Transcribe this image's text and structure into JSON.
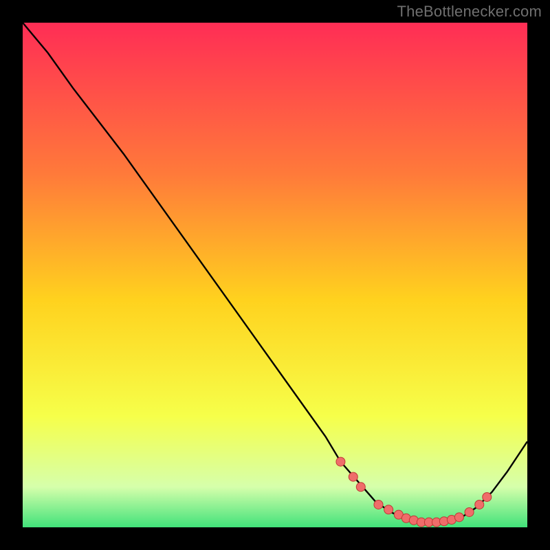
{
  "watermark": "TheBottlenecker.com",
  "colors": {
    "bg": "#000000",
    "watermark": "#6f6f6f",
    "curve": "#000000",
    "dot_fill": "#ef6d6a",
    "dot_stroke": "#c03935",
    "grad_top": "#ff2d55",
    "grad_mid1": "#ff7a3a",
    "grad_mid2": "#ffd21e",
    "grad_mid3": "#f6ff4a",
    "grad_bot1": "#d6ffab",
    "grad_bot2": "#41e27a"
  },
  "chart_data": {
    "type": "line",
    "title": "",
    "xlabel": "",
    "ylabel": "",
    "xlim": [
      0,
      100
    ],
    "ylim": [
      0,
      100
    ],
    "grid": false,
    "legend": false,
    "x": [
      0,
      5,
      10,
      15,
      20,
      25,
      30,
      35,
      40,
      45,
      50,
      55,
      60,
      63,
      66.5,
      70,
      73,
      76,
      79,
      82,
      85,
      87,
      90,
      93,
      96,
      100
    ],
    "values": [
      100,
      94,
      87,
      80.5,
      74,
      67,
      60,
      53,
      46,
      39,
      32,
      25,
      18,
      13,
      9,
      5,
      3,
      1.5,
      1,
      1,
      1.2,
      2,
      4,
      7,
      11,
      17
    ],
    "dots_x": [
      63.0,
      65.5,
      67.0,
      70.5,
      72.5,
      74.5,
      76.0,
      77.5,
      79.0,
      80.5,
      82.0,
      83.5,
      85.0,
      86.5,
      88.5,
      90.5,
      92.0
    ],
    "dots_y": [
      13.0,
      10.0,
      8.0,
      4.5,
      3.5,
      2.5,
      1.8,
      1.4,
      1.0,
      1.0,
      1.0,
      1.2,
      1.5,
      2.0,
      3.0,
      4.5,
      6.0
    ]
  }
}
